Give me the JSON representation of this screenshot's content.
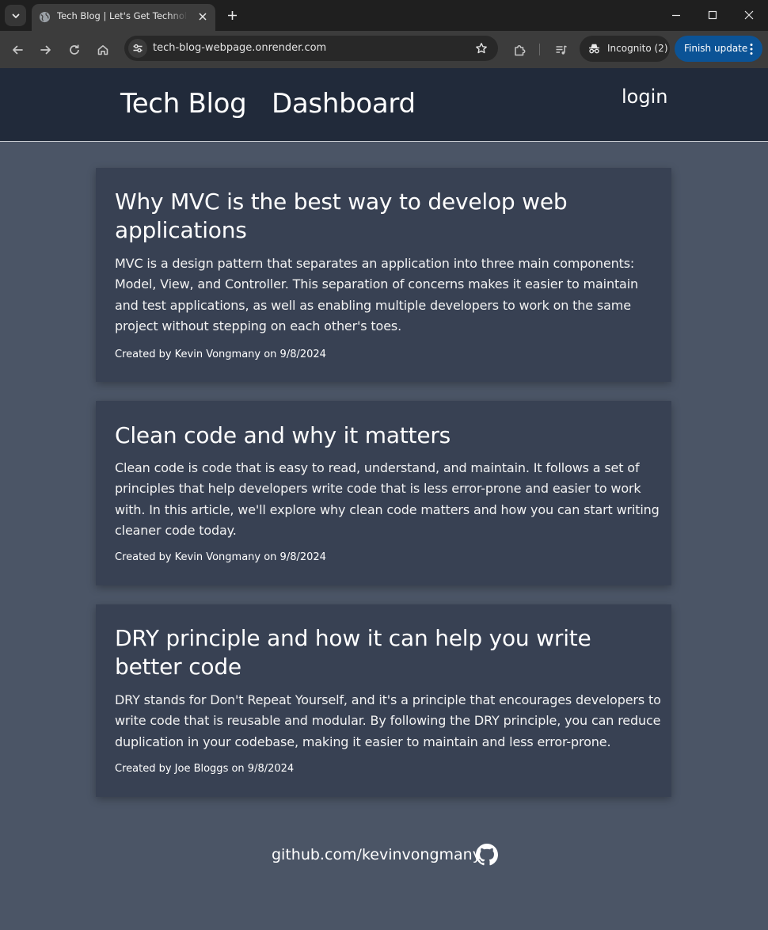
{
  "browser": {
    "tab_title": "Tech Blog | Let's Get Technological",
    "url": "tech-blog-webpage.onrender.com",
    "incognito_label": "Incognito (2)",
    "update_label": "Finish update"
  },
  "header": {
    "brand": "Tech Blog",
    "nav_dashboard": "Dashboard",
    "nav_login": "login"
  },
  "posts": [
    {
      "title": "Why MVC is the best way to develop web applications",
      "body": "MVC is a design pattern that separates an application into three main components: Model, View, and Controller. This separation of concerns makes it easier to maintain and test applications, as well as enabling multiple developers to work on the same project without stepping on each other's toes.",
      "meta": "Created by Kevin Vongmany on 9/8/2024"
    },
    {
      "title": "Clean code and why it matters",
      "body": "Clean code is code that is easy to read, understand, and maintain. It follows a set of principles that help developers write code that is less error-prone and easier to work with. In this article, we'll explore why clean code matters and how you can start writing cleaner code today.",
      "meta": "Created by Kevin Vongmany on 9/8/2024"
    },
    {
      "title": "DRY principle and how it can help you write better code",
      "body": "DRY stands for Don't Repeat Yourself, and it's a principle that encourages developers to write code that is reusable and modular. By following the DRY principle, you can reduce duplication in your codebase, making it easier to maintain and less error-prone.",
      "meta": "Created by Joe Bloggs on 9/8/2024"
    }
  ],
  "footer": {
    "link_text": "github.com/kevinvongmany"
  },
  "icons": {
    "tab_search": "chevron-down-icon",
    "favicon": "globe-icon",
    "tab_close": "close-icon",
    "new_tab": "plus-icon",
    "minimize": "minimize-icon",
    "maximize": "maximize-icon",
    "window_close": "close-icon",
    "back": "arrow-left-icon",
    "forward": "arrow-right-icon",
    "reload": "reload-icon",
    "home": "home-icon",
    "site_info": "tune-icon",
    "bookmark": "star-icon",
    "extensions": "puzzle-icon",
    "media": "playlist-icon",
    "incognito": "incognito-icon",
    "menu": "more-vertical-icon",
    "github": "github-icon"
  },
  "colors": {
    "page_background": "#4b5566",
    "header_background": "#212a3a",
    "card_background": "#384153",
    "update_button": "#0b5396"
  }
}
